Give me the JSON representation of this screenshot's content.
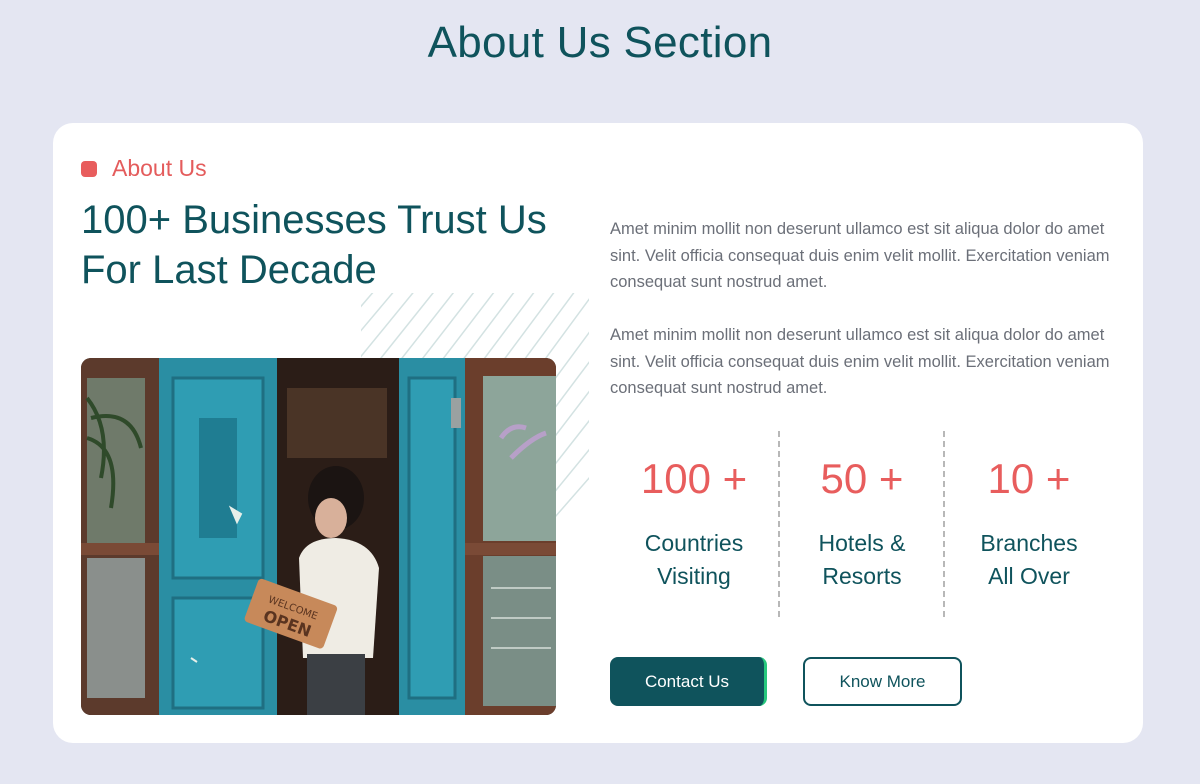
{
  "page": {
    "title": "About Us Section"
  },
  "about": {
    "eyebrow": "About Us",
    "headline_line1": "100+ Businesses Trust Us",
    "headline_line2": "For Last Decade",
    "paragraphs": [
      "Amet minim mollit non deserunt ullamco est sit aliqua dolor do amet sint. Velit officia consequat duis enim velit mollit. Exercitation veniam consequat sunt nostrud amet.",
      "Amet minim mollit non deserunt ullamco est sit aliqua dolor do amet sint. Velit officia consequat duis enim velit mollit. Exercitation veniam consequat sunt nostrud amet."
    ],
    "image_sign_top": "WELCOME",
    "image_sign_bottom": "OPEN"
  },
  "stats": [
    {
      "value": "100 +",
      "line1": "Countries",
      "line2": "Visiting"
    },
    {
      "value": "50 +",
      "line1": "Hotels &",
      "line2": "Resorts"
    },
    {
      "value": "10 +",
      "line1": "Branches",
      "line2": "All Over"
    }
  ],
  "buttons": {
    "contact": "Contact Us",
    "know_more": "Know More"
  },
  "colors": {
    "background": "#e4e6f2",
    "brand_teal": "#0f535c",
    "accent_coral": "#e85d5d",
    "accent_green": "#27c77d",
    "card": "#ffffff"
  }
}
